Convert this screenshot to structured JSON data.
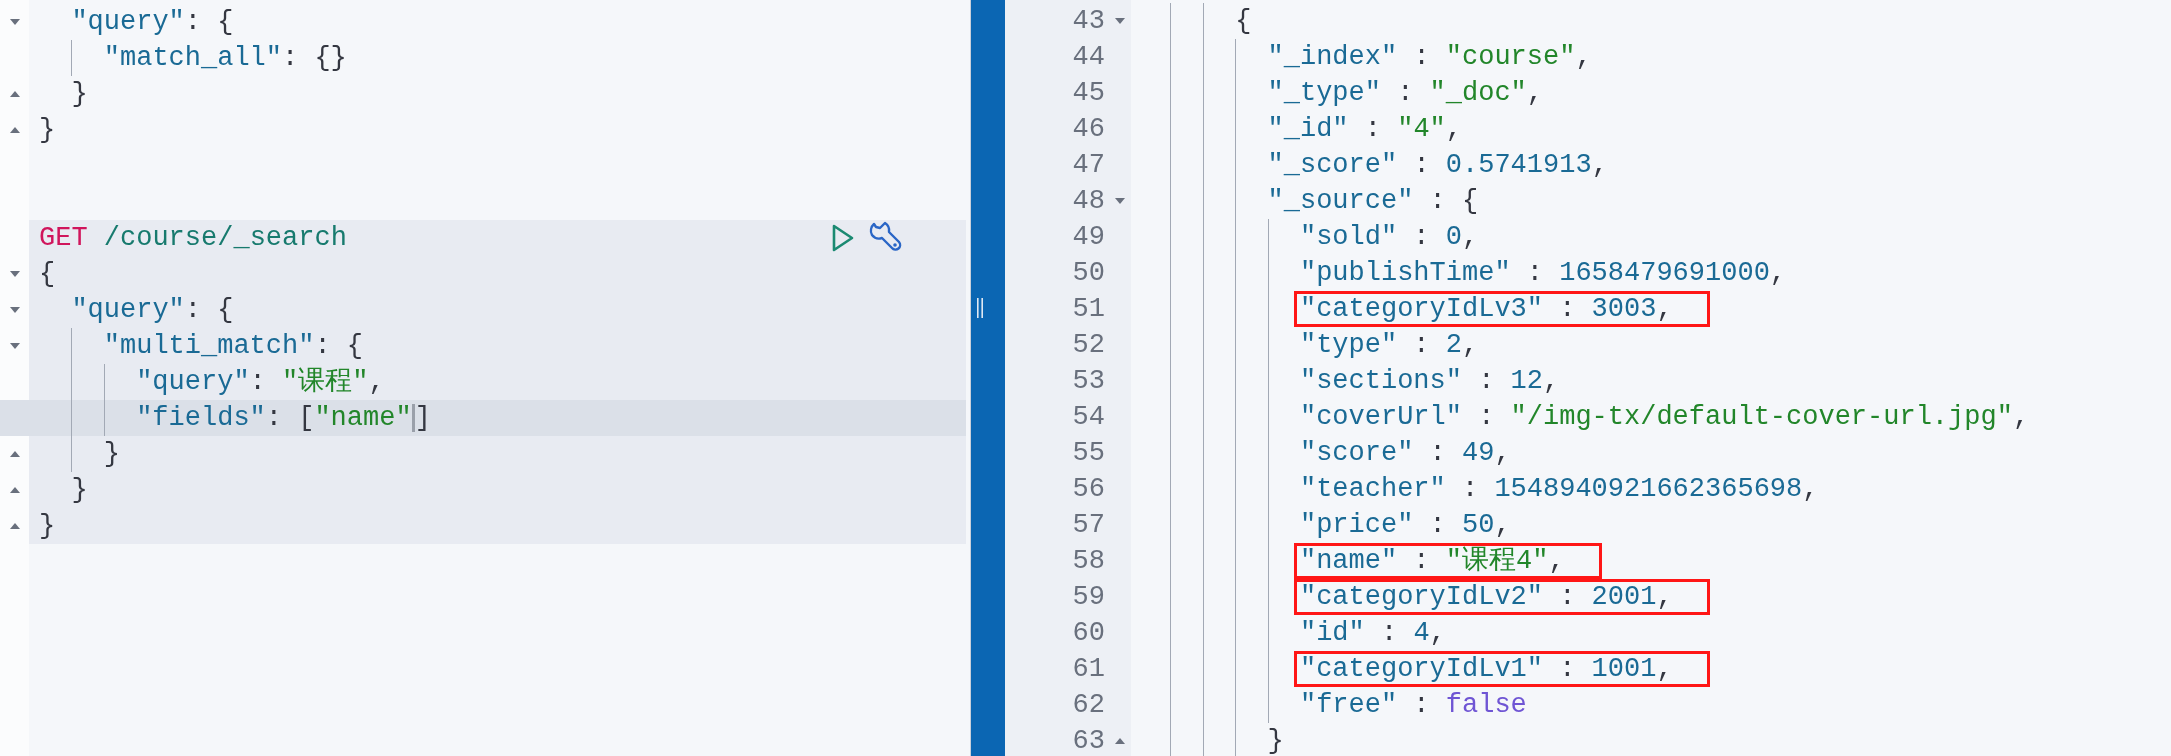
{
  "request_editor": {
    "sections": [
      {
        "selected": false,
        "lines": [
          {
            "children": [
              {
                "fold_start": true,
                "tokens": [
                  {
                    "kind": "key",
                    "text": "\"query\""
                  },
                  {
                    "kind": "punct",
                    "text": ": {"
                  }
                ],
                "children": [
                  {
                    "tokens": [
                      {
                        "kind": "key",
                        "text": "\"match_all\""
                      },
                      {
                        "kind": "punct",
                        "text": ": {}"
                      }
                    ]
                  }
                ]
              },
              {
                "fold_end": true,
                "tokens": [
                  {
                    "kind": "punct",
                    "text": "}"
                  }
                ]
              }
            ]
          },
          {
            "fold_end": true,
            "tokens": [
              {
                "kind": "punct",
                "text": "}"
              }
            ]
          }
        ]
      },
      {
        "selected": true,
        "lines": [
          {
            "tokens": [
              {
                "kind": "method",
                "text": "GET"
              },
              {
                "kind": "path",
                "text": "/course/_search"
              }
            ]
          },
          {
            "fold_start": true,
            "tokens": [
              {
                "kind": "punct",
                "text": "{"
              }
            ],
            "children": [
              {
                "fold_start": true,
                "tokens": [
                  {
                    "kind": "key",
                    "text": "\"query\""
                  },
                  {
                    "kind": "punct",
                    "text": ": {"
                  }
                ],
                "children": [
                  {
                    "fold_start": true,
                    "tokens": [
                      {
                        "kind": "key",
                        "text": "\"multi_match\""
                      },
                      {
                        "kind": "punct",
                        "text": ": {"
                      }
                    ],
                    "children": [
                      {
                        "active": false,
                        "tokens": [
                          {
                            "kind": "key",
                            "text": "\"query\""
                          },
                          {
                            "kind": "punct",
                            "text": ": "
                          },
                          {
                            "kind": "string",
                            "text": "\"课程\""
                          },
                          {
                            "kind": "punct",
                            "text": ","
                          }
                        ]
                      },
                      {
                        "active": true,
                        "tokens": [
                          {
                            "kind": "key",
                            "text": "\"fields\""
                          },
                          {
                            "kind": "punct",
                            "text": ": ["
                          },
                          {
                            "kind": "string",
                            "text": "\"name\""
                          },
                          {
                            "kind": "punct",
                            "text": "]"
                          }
                        ]
                      }
                    ]
                  },
                  {
                    "fold_end": true,
                    "tokens": [
                      {
                        "kind": "punct",
                        "text": "}"
                      }
                    ]
                  }
                ]
              },
              {
                "fold_end": true,
                "tokens": [
                  {
                    "kind": "punct",
                    "text": "}"
                  }
                ]
              }
            ]
          },
          {
            "fold_end": true,
            "tokens": [
              {
                "kind": "punct",
                "text": "}"
              }
            ]
          }
        ]
      }
    ]
  },
  "response_viewer": {
    "lines": [
      {
        "children": [
          {
            "children": [
              {
                "children": [
                  {
                    "number": "43",
                    "fold_start": true,
                    "tokens": [
                      {
                        "kind": "punct",
                        "text": "{"
                      }
                    ],
                    "children": [
                      {
                        "number": "44",
                        "tokens": [
                          {
                            "kind": "key",
                            "text": "\"_index\""
                          },
                          {
                            "kind": "punct",
                            "text": " : "
                          },
                          {
                            "kind": "string",
                            "text": "\"course\""
                          },
                          {
                            "kind": "punct",
                            "text": ","
                          }
                        ]
                      },
                      {
                        "number": "45",
                        "tokens": [
                          {
                            "kind": "key",
                            "text": "\"_type\""
                          },
                          {
                            "kind": "punct",
                            "text": " : "
                          },
                          {
                            "kind": "string",
                            "text": "\"_doc\""
                          },
                          {
                            "kind": "punct",
                            "text": ","
                          }
                        ]
                      },
                      {
                        "number": "46",
                        "tokens": [
                          {
                            "kind": "key",
                            "text": "\"_id\""
                          },
                          {
                            "kind": "punct",
                            "text": " : "
                          },
                          {
                            "kind": "string",
                            "text": "\"4\""
                          },
                          {
                            "kind": "punct",
                            "text": ","
                          }
                        ]
                      },
                      {
                        "number": "47",
                        "tokens": [
                          {
                            "kind": "key",
                            "text": "\"_score\""
                          },
                          {
                            "kind": "punct",
                            "text": " : "
                          },
                          {
                            "kind": "number",
                            "text": "0.5741913"
                          },
                          {
                            "kind": "punct",
                            "text": ","
                          }
                        ]
                      },
                      {
                        "number": "48",
                        "fold_start": true,
                        "tokens": [
                          {
                            "kind": "key",
                            "text": "\"_source\""
                          },
                          {
                            "kind": "punct",
                            "text": " : {"
                          }
                        ],
                        "children": [
                          {
                            "number": "49",
                            "boxed": false,
                            "tokens": [
                              {
                                "kind": "key",
                                "text": "\"sold\""
                              },
                              {
                                "kind": "punct",
                                "text": " : "
                              },
                              {
                                "kind": "number",
                                "text": "0"
                              },
                              {
                                "kind": "punct",
                                "text": ","
                              }
                            ]
                          },
                          {
                            "number": "50",
                            "boxed": false,
                            "tokens": [
                              {
                                "kind": "key",
                                "text": "\"publishTime\""
                              },
                              {
                                "kind": "punct",
                                "text": " : "
                              },
                              {
                                "kind": "number",
                                "text": "1658479691000"
                              },
                              {
                                "kind": "punct",
                                "text": ","
                              }
                            ]
                          },
                          {
                            "number": "51",
                            "boxed": true,
                            "tokens": [
                              {
                                "kind": "key",
                                "text": "\"categoryIdLv3\""
                              },
                              {
                                "kind": "punct",
                                "text": " : "
                              },
                              {
                                "kind": "number",
                                "text": "3003"
                              },
                              {
                                "kind": "punct",
                                "text": ","
                              }
                            ]
                          },
                          {
                            "number": "52",
                            "boxed": false,
                            "tokens": [
                              {
                                "kind": "key",
                                "text": "\"type\""
                              },
                              {
                                "kind": "punct",
                                "text": " : "
                              },
                              {
                                "kind": "number",
                                "text": "2"
                              },
                              {
                                "kind": "punct",
                                "text": ","
                              }
                            ]
                          },
                          {
                            "number": "53",
                            "boxed": false,
                            "tokens": [
                              {
                                "kind": "key",
                                "text": "\"sections\""
                              },
                              {
                                "kind": "punct",
                                "text": " : "
                              },
                              {
                                "kind": "number",
                                "text": "12"
                              },
                              {
                                "kind": "punct",
                                "text": ","
                              }
                            ]
                          },
                          {
                            "number": "54",
                            "boxed": false,
                            "tokens": [
                              {
                                "kind": "key",
                                "text": "\"coverUrl\""
                              },
                              {
                                "kind": "punct",
                                "text": " : "
                              },
                              {
                                "kind": "string",
                                "text": "\"/img-tx/default-cover-url.jpg\""
                              },
                              {
                                "kind": "punct",
                                "text": ","
                              }
                            ]
                          },
                          {
                            "number": "55",
                            "boxed": false,
                            "tokens": [
                              {
                                "kind": "key",
                                "text": "\"score\""
                              },
                              {
                                "kind": "punct",
                                "text": " : "
                              },
                              {
                                "kind": "number",
                                "text": "49"
                              },
                              {
                                "kind": "punct",
                                "text": ","
                              }
                            ]
                          },
                          {
                            "number": "56",
                            "boxed": false,
                            "tokens": [
                              {
                                "kind": "key",
                                "text": "\"teacher\""
                              },
                              {
                                "kind": "punct",
                                "text": " : "
                              },
                              {
                                "kind": "number",
                                "text": "1548940921662365698"
                              },
                              {
                                "kind": "punct",
                                "text": ","
                              }
                            ]
                          },
                          {
                            "number": "57",
                            "boxed": false,
                            "tokens": [
                              {
                                "kind": "key",
                                "text": "\"price\""
                              },
                              {
                                "kind": "punct",
                                "text": " : "
                              },
                              {
                                "kind": "number",
                                "text": "50"
                              },
                              {
                                "kind": "punct",
                                "text": ","
                              }
                            ]
                          },
                          {
                            "number": "58",
                            "boxed": true,
                            "tokens": [
                              {
                                "kind": "key",
                                "text": "\"name\""
                              },
                              {
                                "kind": "punct",
                                "text": " : "
                              },
                              {
                                "kind": "string",
                                "text": "\"课程4\""
                              },
                              {
                                "kind": "punct",
                                "text": ","
                              }
                            ]
                          },
                          {
                            "number": "59",
                            "boxed": true,
                            "tokens": [
                              {
                                "kind": "key",
                                "text": "\"categoryIdLv2\""
                              },
                              {
                                "kind": "punct",
                                "text": " : "
                              },
                              {
                                "kind": "number",
                                "text": "2001"
                              },
                              {
                                "kind": "punct",
                                "text": ","
                              }
                            ]
                          },
                          {
                            "number": "60",
                            "boxed": false,
                            "tokens": [
                              {
                                "kind": "key",
                                "text": "\"id\""
                              },
                              {
                                "kind": "punct",
                                "text": " : "
                              },
                              {
                                "kind": "number",
                                "text": "4"
                              },
                              {
                                "kind": "punct",
                                "text": ","
                              }
                            ]
                          },
                          {
                            "number": "61",
                            "boxed": true,
                            "tokens": [
                              {
                                "kind": "key",
                                "text": "\"categoryIdLv1\""
                              },
                              {
                                "kind": "punct",
                                "text": " : "
                              },
                              {
                                "kind": "number",
                                "text": "1001"
                              },
                              {
                                "kind": "punct",
                                "text": ","
                              }
                            ]
                          },
                          {
                            "number": "62",
                            "boxed": false,
                            "tokens": [
                              {
                                "kind": "key",
                                "text": "\"free\""
                              },
                              {
                                "kind": "punct",
                                "text": " : "
                              },
                              {
                                "kind": "bool",
                                "text": "false"
                              }
                            ]
                          }
                        ]
                      },
                      {
                        "number": "63",
                        "fold_end": true,
                        "tokens": [
                          {
                            "kind": "punct",
                            "text": "}"
                          }
                        ]
                      }
                    ]
                  }
                ]
              }
            ]
          }
        ]
      }
    ]
  }
}
